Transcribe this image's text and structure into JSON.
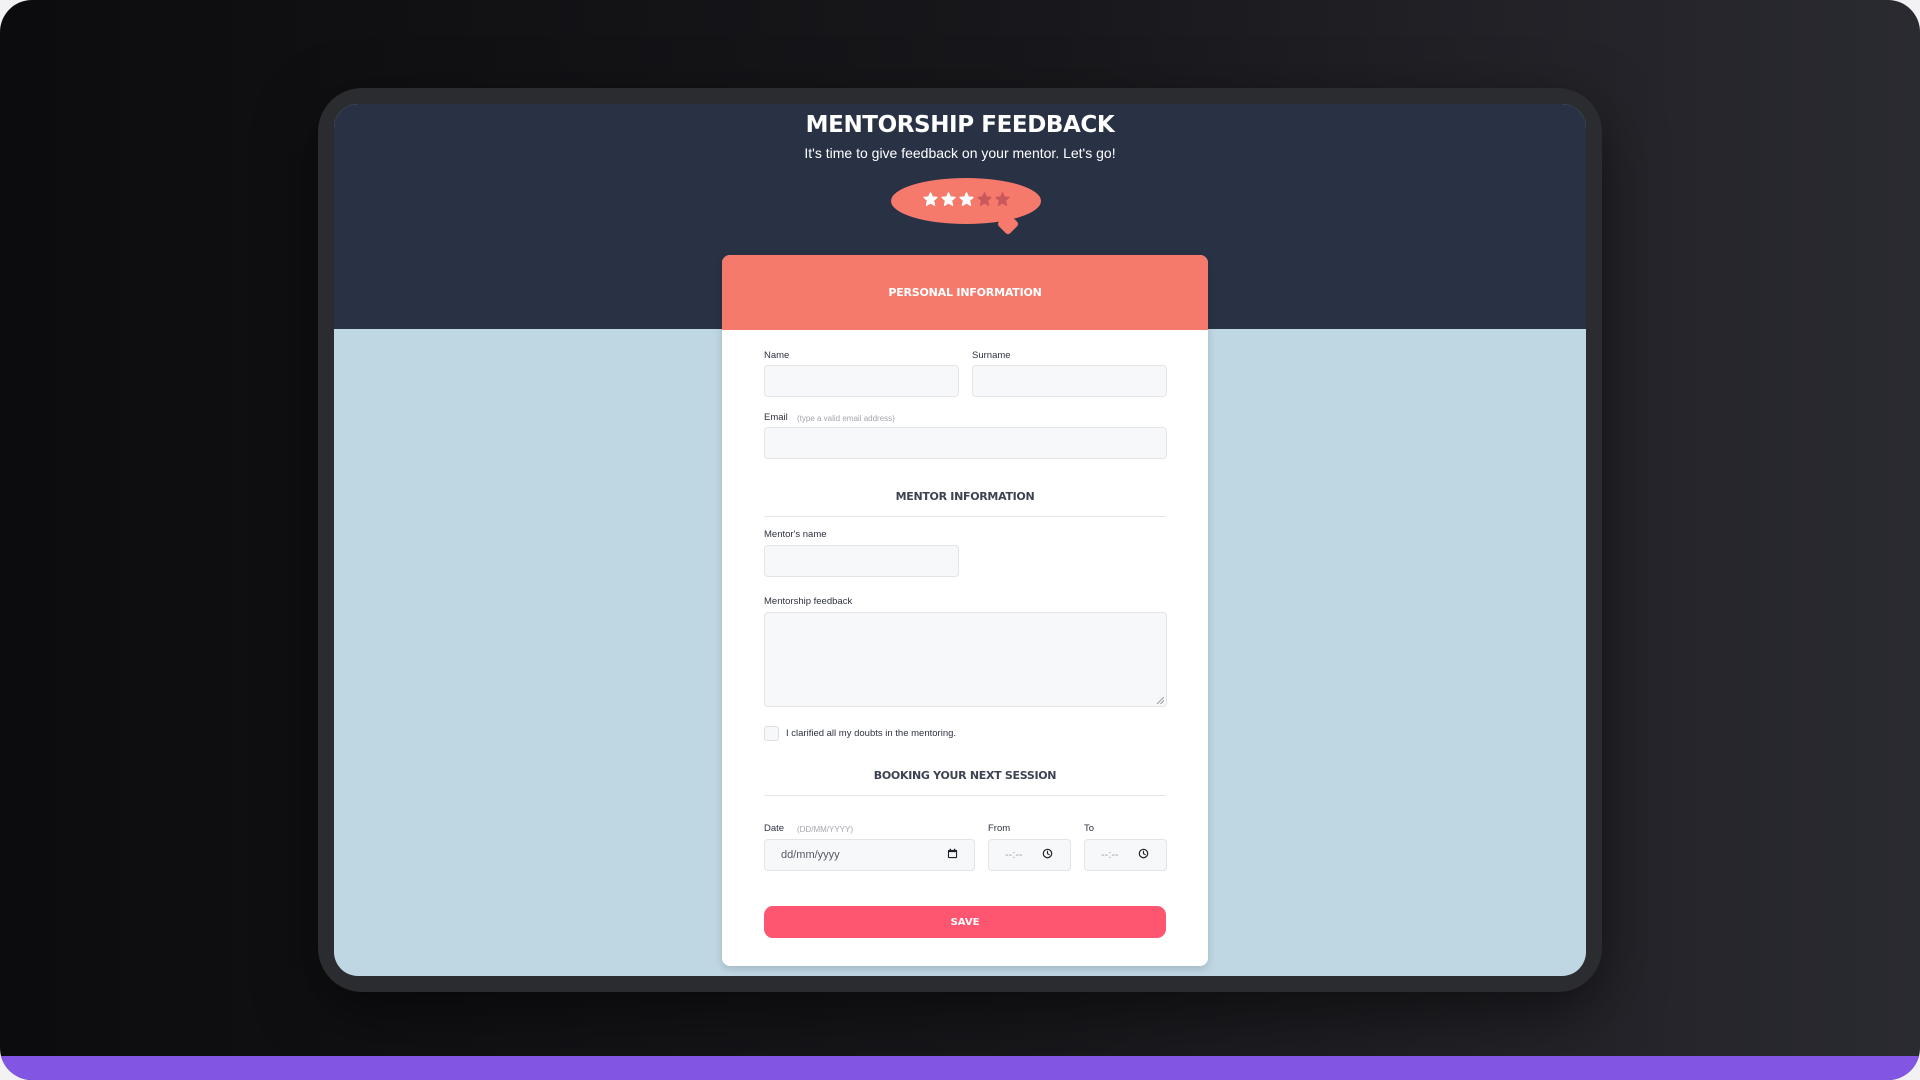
{
  "header": {
    "title": "MENTORSHIP FEEDBACK",
    "subtitle": "It's time to give feedback on your mentor. Let's go!",
    "rating": {
      "value": 3,
      "max": 5,
      "filled_color": "#ffffff",
      "empty_color": "#c9585a"
    }
  },
  "colors": {
    "hero": "#293244",
    "page_background": "#bfd7e3",
    "accent": "#f57a6c",
    "save_button": "#fe5571",
    "footer_bar": "#8256e3"
  },
  "form": {
    "personal_section": "PERSONAL INFORMATION",
    "name_label": "Name",
    "surname_label": "Surname",
    "email_label": "Email",
    "email_hint": "(type a valid email address)",
    "mentor_section": "MENTOR INFORMATION",
    "mentor_name_label": "Mentor's name",
    "feedback_label": "Mentorship feedback",
    "clarified_label": "I clarified all my doubts in the mentoring.",
    "clarified_checked": false,
    "booking_section": "BOOKING YOUR NEXT SESSION",
    "date_label": "Date",
    "date_hint": "(DD/MM/YYYY)",
    "date_placeholder": "dd/mm/yyyy",
    "from_label": "From",
    "from_placeholder": "--:--",
    "to_label": "To",
    "to_placeholder": "--:--",
    "save_label": "SAVE"
  },
  "icons": {
    "rating": "star-icon",
    "date": "calendar-icon",
    "time": "clock-icon"
  }
}
